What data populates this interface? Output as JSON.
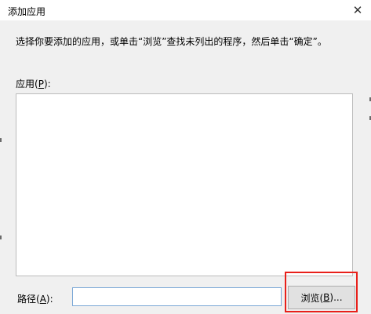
{
  "dialog": {
    "title": "添加应用",
    "close_glyph": "✕",
    "instruction": "选择你要添加的应用，或单击“浏览”查找未列出的程序，然后单击“确定”。"
  },
  "app_list": {
    "label_prefix": "应用(",
    "label_key": "P",
    "label_suffix": "):"
  },
  "path": {
    "label_prefix": "路径(",
    "label_key": "A",
    "label_suffix": "):",
    "value": "",
    "placeholder": ""
  },
  "browse_button": {
    "label_prefix": "浏览(",
    "label_key": "B",
    "label_suffix": ")..."
  },
  "colors": {
    "highlight": "#e8201a",
    "input_border": "#7aa7d6"
  }
}
